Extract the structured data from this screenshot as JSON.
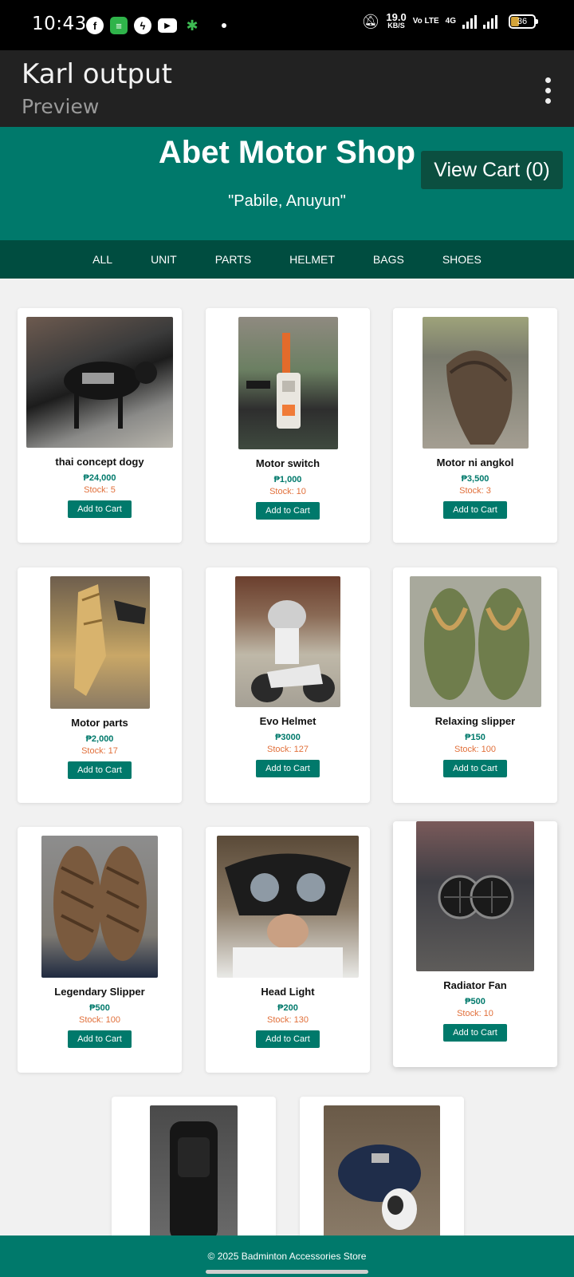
{
  "status_bar": {
    "time": "10:43",
    "speed_value": "19.0",
    "speed_unit": "KB/S",
    "volte": "Vo LTE",
    "net": "4G",
    "battery": "36"
  },
  "app_bar": {
    "title": "Karl output",
    "subtitle": "Preview"
  },
  "shop": {
    "name": "Abet Motor Shop",
    "tagline": "\"Pabile, Anuyun\"",
    "cart_label": "View Cart (0)"
  },
  "nav": [
    "ALL",
    "UNIT",
    "PARTS",
    "HELMET",
    "BAGS",
    "SHOES"
  ],
  "products": [
    {
      "name": "thai concept dogy",
      "price": "₱24,000",
      "stock": "Stock: 5",
      "button": "Add to Cart"
    },
    {
      "name": "Motor switch",
      "price": "₱1,000",
      "stock": "Stock: 10",
      "button": "Add to Cart"
    },
    {
      "name": "Motor ni angkol",
      "price": "₱3,500",
      "stock": "Stock: 3",
      "button": "Add to Cart"
    },
    {
      "name": "Motor parts",
      "price": "₱2,000",
      "stock": "Stock: 17",
      "button": "Add to Cart"
    },
    {
      "name": "Evo Helmet",
      "price": "₱3000",
      "stock": "Stock: 127",
      "button": "Add to Cart"
    },
    {
      "name": "Relaxing slipper",
      "price": "₱150",
      "stock": "Stock: 100",
      "button": "Add to Cart"
    },
    {
      "name": "Legendary Slipper",
      "price": "₱500",
      "stock": "Stock: 100",
      "button": "Add to Cart"
    },
    {
      "name": "Head Light",
      "price": "₱200",
      "stock": "Stock: 130",
      "button": "Add to Cart"
    },
    {
      "name": "Radiator Fan",
      "price": "₱500",
      "stock": "Stock: 10",
      "button": "Add to Cart"
    },
    {
      "name": "",
      "price": "",
      "stock": "",
      "button": ""
    },
    {
      "name": "",
      "price": "",
      "stock": "",
      "button": ""
    }
  ],
  "footer": "© 2025 Badminton Accessories Store"
}
